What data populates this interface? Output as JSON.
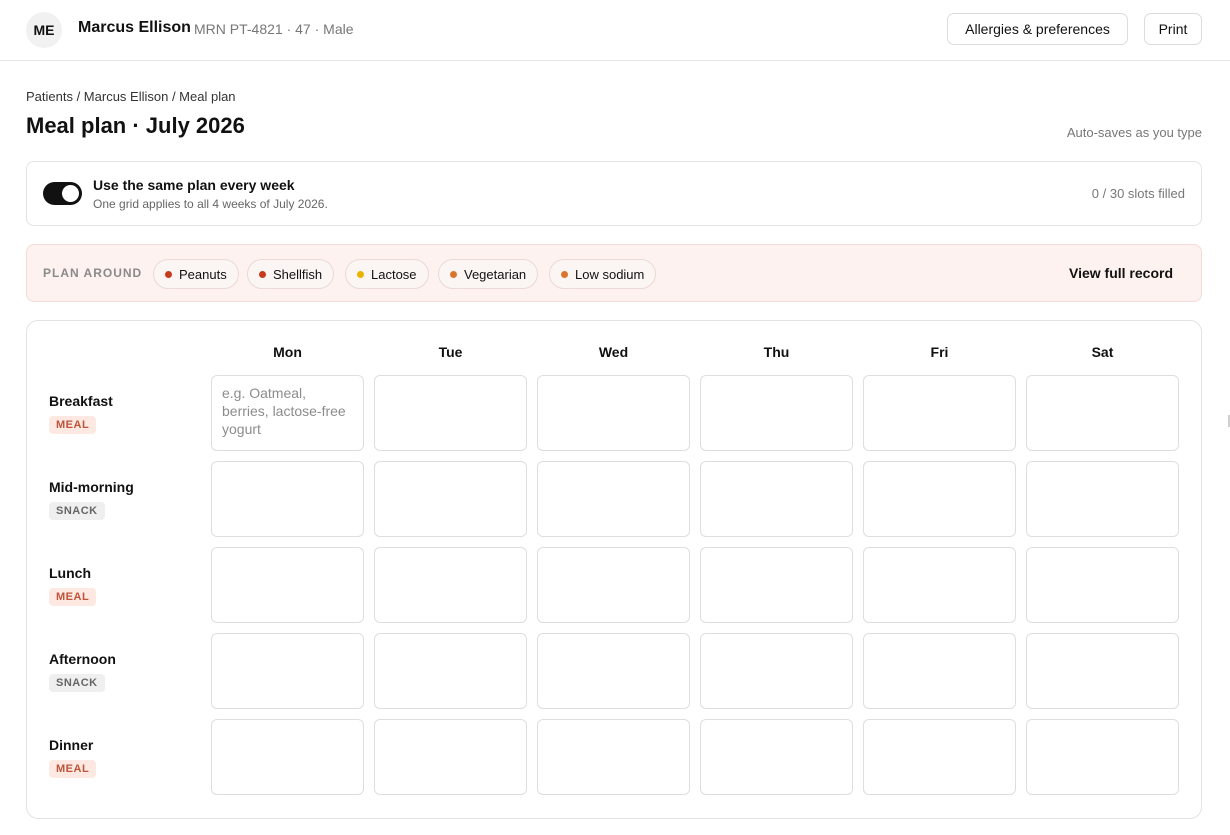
{
  "header": {
    "avatar_initials": "ME",
    "patient_name": "Marcus Ellison",
    "patient_meta": "MRN PT-4821 · 47 · Male",
    "allergies_button": "Allergies & preferences",
    "print_button": "Print"
  },
  "breadcrumb": "Patients / Marcus Ellison / Meal plan",
  "page_title": "Meal plan · July 2026",
  "autosave_note": "Auto-saves as you type",
  "weekly": {
    "toggle_on": true,
    "title": "Use the same plan every week",
    "subtitle": "One grid applies to all 4 weeks of July 2026.",
    "slots_filled": "0 / 30 slots filled"
  },
  "plan_around": {
    "label": "PLAN AROUND",
    "chips": [
      {
        "label": "Peanuts",
        "color": "#c53b1b"
      },
      {
        "label": "Shellfish",
        "color": "#c53b1b"
      },
      {
        "label": "Lactose",
        "color": "#e8b400"
      },
      {
        "label": "Vegetarian",
        "color": "#d9752f"
      },
      {
        "label": "Low sodium",
        "color": "#d9752f"
      }
    ],
    "view_record": "View full record"
  },
  "grid": {
    "days": [
      "Mon",
      "Tue",
      "Wed",
      "Thu",
      "Fri",
      "Sat"
    ],
    "rows": [
      {
        "label": "Breakfast",
        "tag": "MEAL",
        "kind": "meal"
      },
      {
        "label": "Mid-morning",
        "tag": "SNACK",
        "kind": "snack"
      },
      {
        "label": "Lunch",
        "tag": "MEAL",
        "kind": "meal"
      },
      {
        "label": "Afternoon",
        "tag": "SNACK",
        "kind": "snack"
      },
      {
        "label": "Dinner",
        "tag": "MEAL",
        "kind": "meal"
      }
    ],
    "first_cell_placeholder": "e.g. Oatmeal, berries, lactose-free yogurt"
  }
}
